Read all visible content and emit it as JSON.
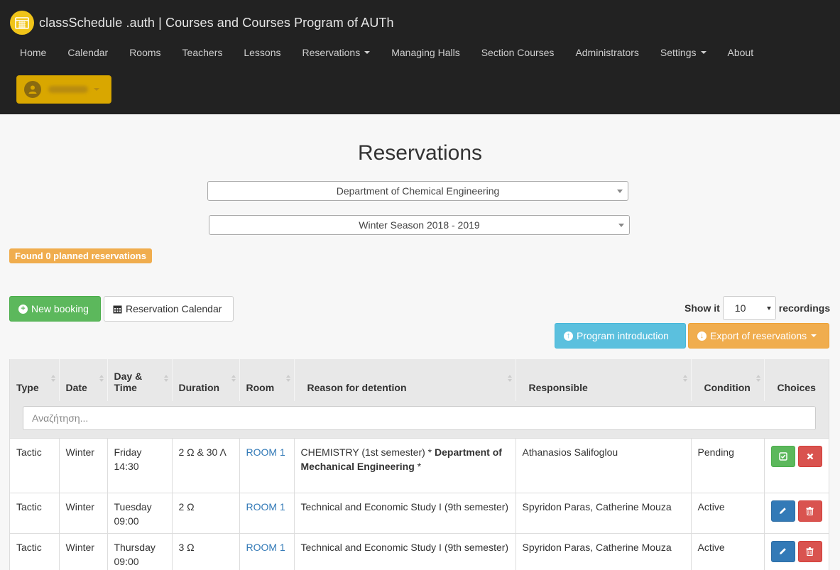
{
  "app": {
    "title": "classSchedule .auth | Courses and Courses Program of AUTh",
    "brand_color": "#f0c419"
  },
  "nav": {
    "items": [
      {
        "label": "Home",
        "dropdown": false
      },
      {
        "label": "Calendar",
        "dropdown": false
      },
      {
        "label": "Rooms",
        "dropdown": false
      },
      {
        "label": "Teachers",
        "dropdown": false
      },
      {
        "label": "Lessons",
        "dropdown": false
      },
      {
        "label": "Reservations",
        "dropdown": true
      },
      {
        "label": "Managing Halls",
        "dropdown": false
      },
      {
        "label": "Section Courses",
        "dropdown": false
      },
      {
        "label": "Administrators",
        "dropdown": false
      },
      {
        "label": "Settings",
        "dropdown": true
      },
      {
        "label": "About",
        "dropdown": false
      }
    ]
  },
  "user_menu": {
    "icon": "user-icon",
    "name_blurred": true
  },
  "page": {
    "title": "Reservations",
    "department_select": "Department of Chemical Engineering",
    "season_select": "Winter Season 2018 - 2019",
    "found_badge": "Found 0 planned reservations"
  },
  "toolbar": {
    "new_booking": "New booking",
    "reservation_calendar": "Reservation Calendar",
    "program_introduction": "Program introduction",
    "export_reservations": "Export of reservations",
    "show_label": "Show it",
    "show_value": "10",
    "recordings_label": "recordings"
  },
  "table": {
    "columns": [
      {
        "label": "Type",
        "sortable": true
      },
      {
        "label": "Date",
        "sortable": true
      },
      {
        "label": "Day & Time",
        "sortable": true
      },
      {
        "label": "Duration",
        "sortable": true
      },
      {
        "label": "Room",
        "sortable": true
      },
      {
        "label": "Reason for detention",
        "sortable": true
      },
      {
        "label": "Responsible",
        "sortable": true
      },
      {
        "label": "Condition",
        "sortable": true
      },
      {
        "label": "Choices",
        "sortable": false
      }
    ],
    "search_placeholder": "Αναζήτηση...",
    "rows": [
      {
        "type": "Tactic",
        "date": "Winter",
        "day": "Friday",
        "time": "14:30",
        "duration": "2 Ω & 30 Λ",
        "room": "ROOM 1",
        "reason": "CHEMISTRY (1st semester) * ",
        "reason_bold": "Department of Mechanical Engineering",
        "reason_tail": " *",
        "responsible": "Athanasios Salifoglou",
        "condition": "Pending",
        "actions": [
          "approve",
          "reject"
        ]
      },
      {
        "type": "Tactic",
        "date": "Winter",
        "day": "Tuesday",
        "time": "09:00",
        "duration": "2 Ω",
        "room": "ROOM 1",
        "reason": "Technical and Economic Study I (9th semester)",
        "reason_bold": "",
        "reason_tail": "",
        "responsible": "Spyridon Paras, Catherine Mouza",
        "condition": "Active",
        "actions": [
          "edit",
          "delete"
        ]
      },
      {
        "type": "Tactic",
        "date": "Winter",
        "day": "Thursday",
        "time": "09:00",
        "duration": "3 Ω",
        "room": "ROOM 1",
        "reason": "Technical and Economic Study I (9th semester)",
        "reason_bold": "",
        "reason_tail": "",
        "responsible": "Spyridon Paras, Catherine Mouza",
        "condition": "Active",
        "actions": [
          "edit",
          "delete"
        ]
      }
    ]
  },
  "colors": {
    "success": "#5cb85c",
    "danger": "#d9534f",
    "info": "#5bc0de",
    "warning": "#f0ad4e",
    "primary": "#337ab7"
  }
}
